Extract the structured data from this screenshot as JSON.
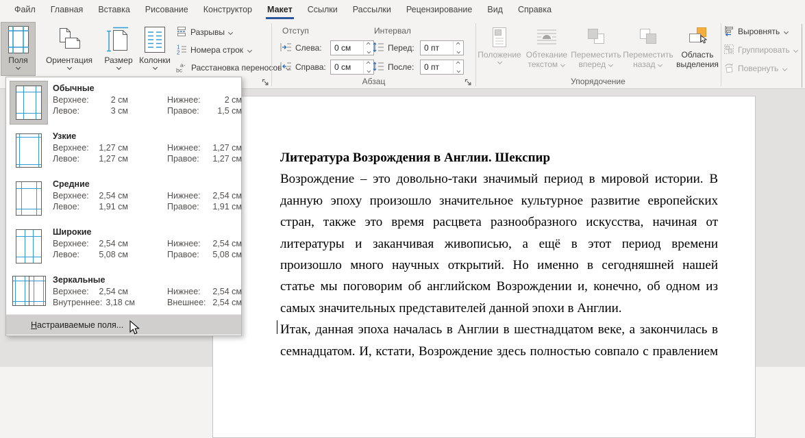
{
  "ribbon_tabs": {
    "active": "Макет",
    "items": [
      {
        "label": "Файл"
      },
      {
        "label": "Главная"
      },
      {
        "label": "Вставка"
      },
      {
        "label": "Рисование"
      },
      {
        "label": "Конструктор"
      },
      {
        "label": "Макет"
      },
      {
        "label": "Ссылки"
      },
      {
        "label": "Рассылки"
      },
      {
        "label": "Рецензирование"
      },
      {
        "label": "Вид"
      },
      {
        "label": "Справка"
      }
    ]
  },
  "page_setup_group": {
    "margins": "Поля",
    "orientation": "Ориентация",
    "size": "Размер",
    "columns": "Колонки",
    "breaks": "Разрывы",
    "line_numbers": "Номера строк",
    "hyphenation": "Расстановка переносов"
  },
  "paragraph_group": {
    "label": "Абзац",
    "indent": "Отступ",
    "spacing": "Интервал",
    "left_label": "Слева:",
    "left_value": "0 см",
    "right_label": "Справа:",
    "right_value": "0 см",
    "before_label": "Перед:",
    "before_value": "0 пт",
    "after_label": "После:",
    "after_value": "0 пт"
  },
  "arrange_group": {
    "label": "Упорядочение",
    "position": "Положение",
    "wrap_line1": "Обтекание",
    "wrap_line2": "текстом",
    "forward_line1": "Переместить",
    "forward_line2": "вперед",
    "backward_line1": "Переместить",
    "backward_line2": "назад",
    "selection_line1": "Область",
    "selection_line2": "выделения",
    "align": "Выровнять",
    "group": "Группировать",
    "rotate": "Повернуть"
  },
  "margins_menu": {
    "items": [
      {
        "name": "Обычные",
        "l1": "Верхнее:",
        "v1": "2 см",
        "l2": "Нижнее:",
        "v2": "2 см",
        "l3": "Левое:",
        "v3": "3 см",
        "l4": "Правое:",
        "v4": "1,5 см"
      },
      {
        "name": "Узкие",
        "l1": "Верхнее:",
        "v1": "1,27 см",
        "l2": "Нижнее:",
        "v2": "1,27 см",
        "l3": "Левое:",
        "v3": "1,27 см",
        "l4": "Правое:",
        "v4": "1,27 см"
      },
      {
        "name": "Средние",
        "l1": "Верхнее:",
        "v1": "2,54 см",
        "l2": "Нижнее:",
        "v2": "2,54 см",
        "l3": "Левое:",
        "v3": "1,91 см",
        "l4": "Правое:",
        "v4": "1,91 см"
      },
      {
        "name": "Широкие",
        "l1": "Верхнее:",
        "v1": "2,54 см",
        "l2": "Нижнее:",
        "v2": "2,54 см",
        "l3": "Левое:",
        "v3": "5,08 см",
        "l4": "Правое:",
        "v4": "5,08 см"
      },
      {
        "name": "Зеркальные",
        "l1": "Верхнее:",
        "v1": "2,54 см",
        "l2": "Нижнее:",
        "v2": "2,54 см",
        "l3": "Внутреннее:",
        "v3": "3,18 см",
        "l4": "Внешнее:",
        "v4": "2,54 см"
      }
    ],
    "selected": "Обычные",
    "custom_accel": "Н",
    "custom_rest": "астраиваемые поля..."
  },
  "document": {
    "title": "Литература Возрождения в Англии. Шекспир",
    "lines": [
      {
        "t": "Возрождение – это довольно-таки значимый период в мировой истории. В"
      },
      {
        "t": "данную эпоху произошло значительное культурное развитие европейских"
      },
      {
        "t": "стран, также это время расцвета разнообразного искусства, начиная от"
      },
      {
        "t": "литературы и заканчивая живописью, а ещё в этот период времени"
      },
      {
        "t": "произошло много научных открытий. Но именно в сегодняшней нашей"
      },
      {
        "t": "статье мы поговорим об английском Возрождении и, конечно, об одном из"
      },
      {
        "t": "самых значительных представителей данной эпохи в Англии."
      },
      {
        "t": "Итак, данная эпоха началась в Англии в шестнадцатом веке, а закончилась в"
      },
      {
        "t": "семнадцатом. И, кстати, Возрождение здесь полностью совпало с правлением"
      }
    ]
  },
  "colors": {
    "accent": "#2b579a",
    "icon_blue": "#339cd4",
    "selection_orange": "#f5ae3d",
    "pressed_gray": "#c7c5c2"
  }
}
